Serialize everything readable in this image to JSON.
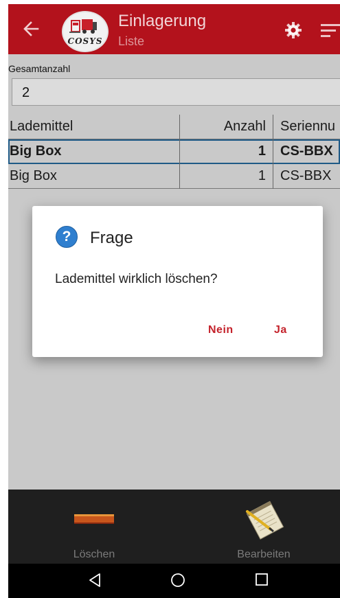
{
  "app": {
    "title": "Einlagerung",
    "subtitle": "Liste",
    "logo_text": "COSYS",
    "accent_color": "#b3121c"
  },
  "toolbar": {
    "back_icon": "arrow-left-icon",
    "settings_icon": "gear-icon",
    "sort_icon": "sort-icon"
  },
  "total": {
    "label": "Gesamtanzahl",
    "value": "2"
  },
  "table": {
    "headers": [
      "Lademittel",
      "Anzahl",
      "Seriennu"
    ],
    "rows": [
      {
        "lademittel": "Big Box",
        "anzahl": "1",
        "serien": "CS-BBX",
        "selected": true
      },
      {
        "lademittel": "Big Box",
        "anzahl": "1",
        "serien": "CS-BBX",
        "selected": false
      }
    ]
  },
  "dialog": {
    "icon": "question-icon",
    "title": "Frage",
    "message": "Lademittel wirklich löschen?",
    "no_label": "Nein",
    "yes_label": "Ja"
  },
  "actions": [
    {
      "label": "Löschen",
      "icon": "delete-bar-icon"
    },
    {
      "label": "Bearbeiten",
      "icon": "notepad-pencil-icon"
    }
  ],
  "navbar": {
    "back": "nav-back-icon",
    "home": "nav-home-icon",
    "recents": "nav-recents-icon"
  }
}
